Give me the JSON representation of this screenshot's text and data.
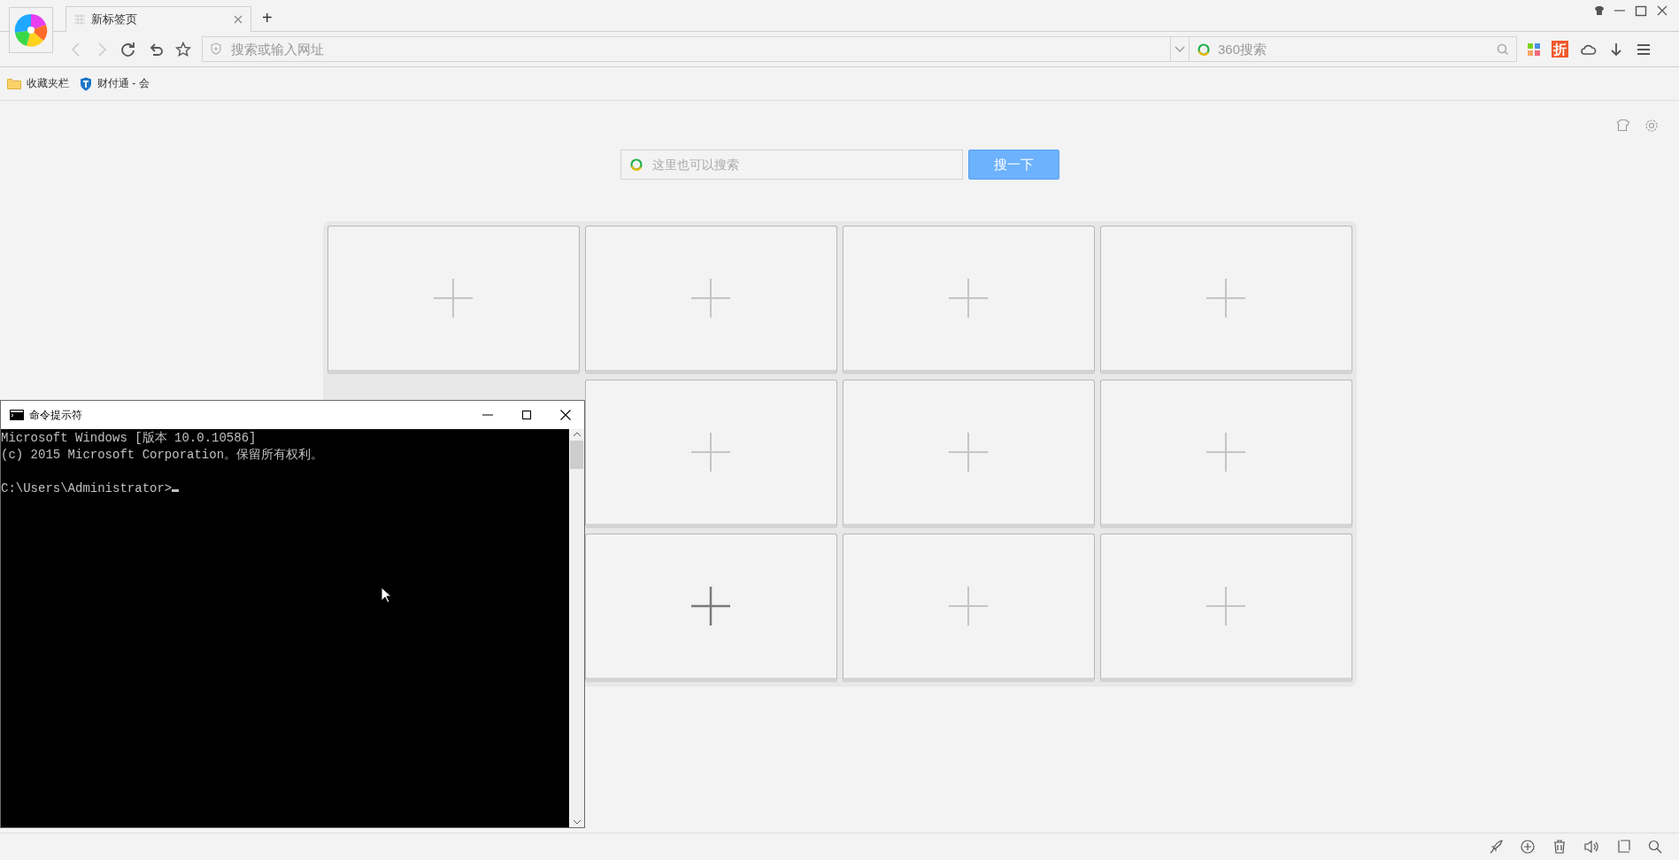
{
  "browser": {
    "tab": {
      "title": "新标签页",
      "selected": true
    },
    "new_tab_button": "+",
    "address_bar": {
      "placeholder": "搜索或输入网址"
    },
    "search_bar": {
      "placeholder": "360搜索"
    },
    "discount_badge": "折",
    "bookmarks": [
      {
        "label": "收藏夹栏",
        "kind": "folder"
      },
      {
        "label": "财付通 - 会",
        "kind": "site"
      }
    ]
  },
  "new_tab_page": {
    "search": {
      "placeholder": "这里也可以搜索",
      "button": "搜一下"
    },
    "tile_rows": [
      [
        {
          "hover": false
        },
        {
          "hover": false
        },
        {
          "hover": false
        },
        {
          "hover": false
        }
      ],
      [
        {
          "hover": false
        },
        {
          "hover": false
        },
        {
          "hover": false
        }
      ],
      [
        {
          "hover": true
        },
        {
          "hover": false
        },
        {
          "hover": false
        }
      ]
    ]
  },
  "cmd_window": {
    "title": "命令提示符",
    "output": [
      "Microsoft Windows [版本 10.0.10586]",
      "(c) 2015 Microsoft Corporation。保留所有权利。"
    ],
    "prompt": "C:\\Users\\Administrator>"
  }
}
